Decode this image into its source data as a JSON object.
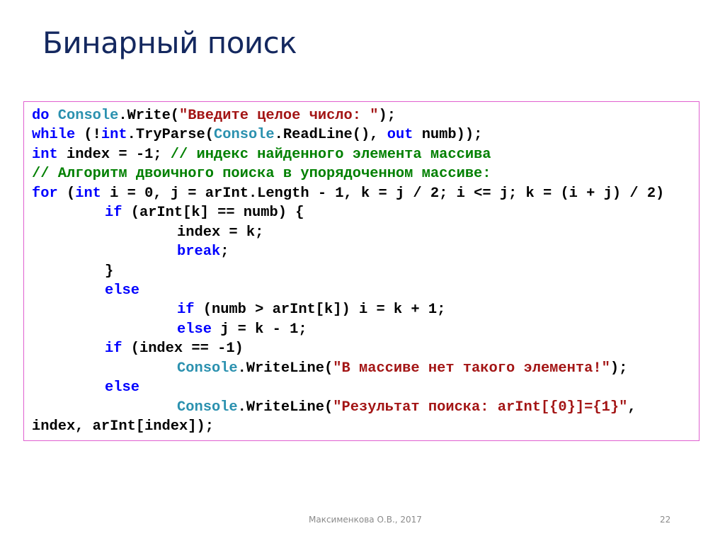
{
  "slide": {
    "title": "Бинарный поиск",
    "footer_author": "Максименкова О.В., 2017",
    "page_number": "22"
  },
  "colors": {
    "keyword": "#0000FF",
    "type": "#2B91AF",
    "string": "#A31515",
    "comment": "#008000",
    "title": "#14285F",
    "box_border": "#E060D0"
  },
  "code": {
    "lines": [
      {
        "indent": 0,
        "tokens": [
          [
            "k",
            "do"
          ],
          [
            "p",
            " "
          ],
          [
            "t",
            "Console"
          ],
          [
            "p",
            ".Write("
          ],
          [
            "s",
            "\"Введите целое число: \""
          ],
          [
            "p",
            ");"
          ]
        ]
      },
      {
        "indent": 0,
        "tokens": [
          [
            "k",
            "while"
          ],
          [
            "p",
            " (!"
          ],
          [
            "k",
            "int"
          ],
          [
            "p",
            ".TryParse("
          ],
          [
            "t",
            "Console"
          ],
          [
            "p",
            ".ReadLine(), "
          ],
          [
            "k",
            "out"
          ],
          [
            "p",
            " numb));"
          ]
        ]
      },
      {
        "indent": 0,
        "tokens": [
          [
            "k",
            "int"
          ],
          [
            "p",
            " index = -1; "
          ],
          [
            "c",
            "// индекс найденного элемента массива"
          ]
        ]
      },
      {
        "indent": 0,
        "tokens": [
          [
            "c",
            "// Алгоритм двоичного поиска в упорядоченном массиве:"
          ]
        ]
      },
      {
        "indent": 0,
        "tokens": [
          [
            "k",
            "for"
          ],
          [
            "p",
            " ("
          ],
          [
            "k",
            "int"
          ],
          [
            "p",
            " i = 0, j = arInt.Length - 1, k = j / 2; i <= j; k = (i + j) / 2)"
          ]
        ]
      },
      {
        "indent": 1,
        "tokens": [
          [
            "k",
            "if"
          ],
          [
            "p",
            " (arInt[k] == numb) {"
          ]
        ]
      },
      {
        "indent": 2,
        "tokens": [
          [
            "p",
            "index = k;"
          ]
        ]
      },
      {
        "indent": 2,
        "tokens": [
          [
            "k",
            "break"
          ],
          [
            "p",
            ";"
          ]
        ]
      },
      {
        "indent": 1,
        "tokens": [
          [
            "p",
            "}"
          ]
        ]
      },
      {
        "indent": 1,
        "tokens": [
          [
            "k",
            "else"
          ]
        ]
      },
      {
        "indent": 2,
        "tokens": [
          [
            "k",
            "if"
          ],
          [
            "p",
            " (numb > arInt[k]) i = k + 1;"
          ]
        ]
      },
      {
        "indent": 2,
        "tokens": [
          [
            "k",
            "else"
          ],
          [
            "p",
            " j = k - 1;"
          ]
        ]
      },
      {
        "indent": 1,
        "tokens": [
          [
            "k",
            "if"
          ],
          [
            "p",
            " (index == -1)"
          ]
        ]
      },
      {
        "indent": 2,
        "tokens": [
          [
            "t",
            "Console"
          ],
          [
            "p",
            ".WriteLine("
          ],
          [
            "s",
            "\"В массиве нет такого элемента!\""
          ],
          [
            "p",
            ");"
          ]
        ]
      },
      {
        "indent": 1,
        "tokens": [
          [
            "k",
            "else"
          ]
        ]
      },
      {
        "indent": 2,
        "tokens": [
          [
            "t",
            "Console"
          ],
          [
            "p",
            ".WriteLine("
          ],
          [
            "s",
            "\"Результат поиска: arInt[{0}]={1}\""
          ],
          [
            "p",
            ","
          ]
        ]
      },
      {
        "indent": 0,
        "tokens": [
          [
            "p",
            "index, arInt[index]);"
          ]
        ]
      }
    ]
  }
}
